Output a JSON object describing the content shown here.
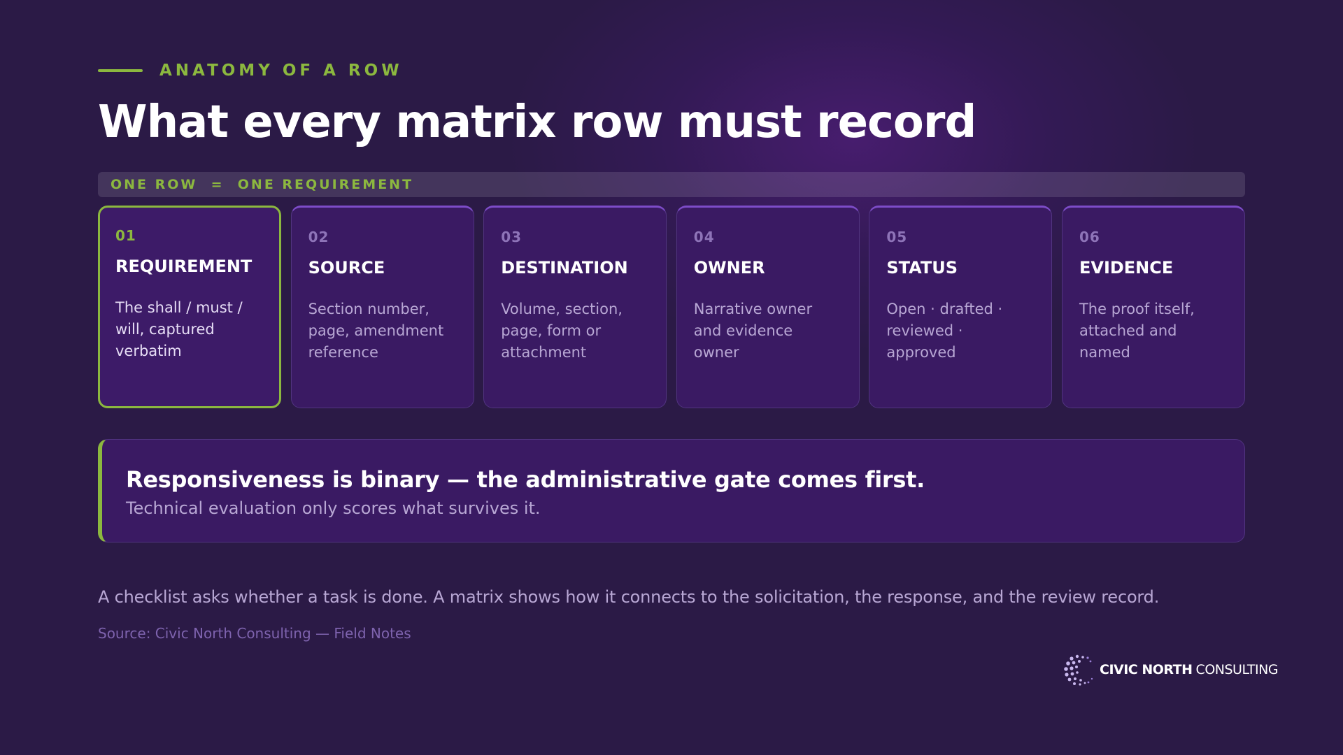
{
  "header": {
    "eyebrow": "ANATOMY OF A ROW",
    "title": "What every matrix row must record"
  },
  "band": {
    "text": "ONE ROW  =  ONE REQUIREMENT"
  },
  "cards": [
    {
      "num": "01",
      "title": "REQUIREMENT",
      "desc": "The shall / must / will, captured verbatim",
      "active": true
    },
    {
      "num": "02",
      "title": "SOURCE",
      "desc": "Section number, page, amendment reference",
      "active": false
    },
    {
      "num": "03",
      "title": "DESTINATION",
      "desc": "Volume, section, page, form or attachment",
      "active": false
    },
    {
      "num": "04",
      "title": "OWNER",
      "desc": "Narrative owner and evidence owner",
      "active": false
    },
    {
      "num": "05",
      "title": "STATUS",
      "desc": "Open · drafted · reviewed · approved",
      "active": false
    },
    {
      "num": "06",
      "title": "EVIDENCE",
      "desc": "The proof itself, attached and named",
      "active": false
    }
  ],
  "callout": {
    "headline": "Responsiveness is binary — the administrative gate comes first.",
    "subtext": "Technical evaluation only scores what survives it."
  },
  "footnote": "A checklist asks whether a task is done. A matrix shows how it connects to the solicitation, the response, and the review record.",
  "source": "Source: Civic North Consulting — Field Notes",
  "logo": {
    "bold": "CIVIC NORTH",
    "light": "CONSULTING",
    "icon": "dotted-globe-icon"
  },
  "colors": {
    "accent_green": "#8cb83f",
    "card_bg": "#3a1a63",
    "background": "#2b1a46",
    "muted_text": "#b8a7d4"
  }
}
